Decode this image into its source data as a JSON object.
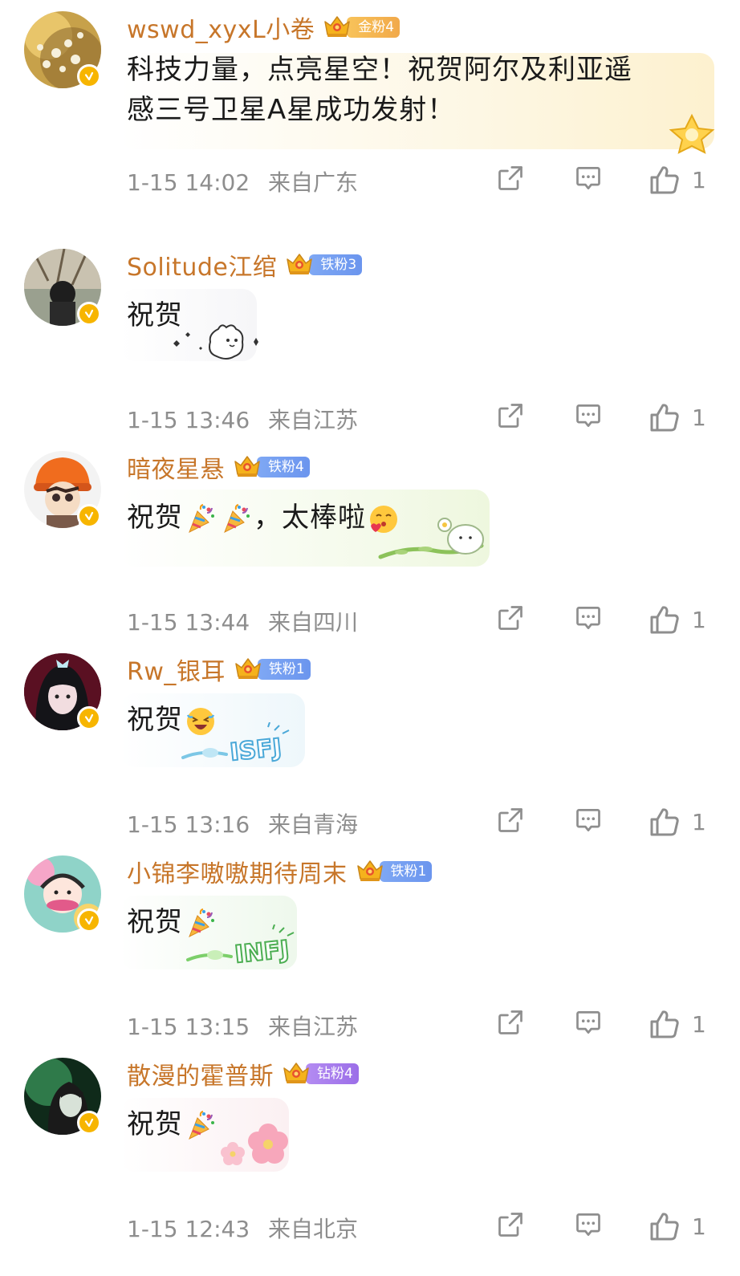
{
  "comments": [
    {
      "username": "wswd_xyxL小卷",
      "badge": {
        "label": "金粉4",
        "tier": "gold"
      },
      "content_line1": "科技力量，点亮星空！祝贺阿尔及利亚遥",
      "content_line2": "感三号卫星A星成功发射！",
      "time": "1-15 14:02",
      "location": "来自广东",
      "likes": "1"
    },
    {
      "username": "Solitude江绾",
      "badge": {
        "label": "铁粉3",
        "tier": "iron"
      },
      "content": "祝贺",
      "time": "1-15 13:46",
      "location": "来自江苏",
      "likes": "1"
    },
    {
      "username": "暗夜星悬",
      "badge": {
        "label": "铁粉4",
        "tier": "iron"
      },
      "content_a": "祝贺",
      "content_b": "，太棒啦",
      "time": "1-15 13:44",
      "location": "来自四川",
      "likes": "1"
    },
    {
      "username": "Rw_银耳",
      "badge": {
        "label": "铁粉1",
        "tier": "iron"
      },
      "content": "祝贺",
      "sticker_text": "ISFJ",
      "time": "1-15 13:16",
      "location": "来自青海",
      "likes": "1"
    },
    {
      "username": "小锦李嗷嗷期待周末",
      "badge": {
        "label": "铁粉1",
        "tier": "iron"
      },
      "content": "祝贺",
      "sticker_text": "INFJ",
      "time": "1-15 13:15",
      "location": "来自江苏",
      "likes": "1"
    },
    {
      "username": "散漫的霍普斯",
      "badge": {
        "label": "钻粉4",
        "tier": "diamond"
      },
      "content": "祝贺",
      "time": "1-15 12:43",
      "location": "来自北京",
      "likes": "1"
    }
  ],
  "icons": {
    "share": "share-icon",
    "reply": "comment-icon",
    "like": "thumbs-up-icon",
    "verified": "verified-badge-icon",
    "crown": "crown-icon"
  },
  "colors": {
    "username": "#c7762a",
    "meta": "#8e8e8e",
    "verified": "#f7b500"
  }
}
